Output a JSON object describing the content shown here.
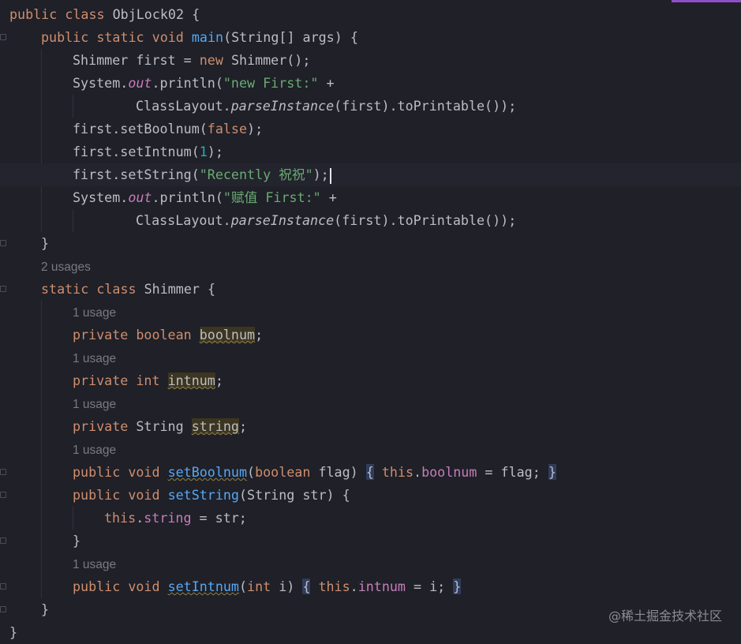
{
  "editor": {
    "lines": [
      {
        "id": "l1",
        "segments": [
          [
            "kw",
            "public class "
          ],
          [
            "plain",
            "ObjLock02 {"
          ]
        ]
      },
      {
        "id": "l2",
        "segments": [
          [
            "kw",
            "public static void "
          ],
          [
            "fn",
            "main"
          ],
          [
            "plain",
            "(String[] args) {"
          ]
        ]
      },
      {
        "id": "l3",
        "segments": [
          [
            "plain",
            "Shimmer first = "
          ],
          [
            "kw",
            "new "
          ],
          [
            "plain",
            "Shimmer();"
          ]
        ]
      },
      {
        "id": "l4",
        "segments": [
          [
            "plain",
            "System."
          ],
          [
            "out",
            "out"
          ],
          [
            "plain",
            ".println("
          ],
          [
            "str",
            "\"new First:\""
          ],
          [
            "plain",
            " +"
          ]
        ]
      },
      {
        "id": "l5",
        "segments": [
          [
            "plain",
            "ClassLayout."
          ],
          [
            "itl",
            "parseInstance"
          ],
          [
            "plain",
            "(first).toPrintable());"
          ]
        ]
      },
      {
        "id": "l6",
        "segments": [
          [
            "plain",
            "first.setBoolnum("
          ],
          [
            "kw",
            "false"
          ],
          [
            "plain",
            ");"
          ]
        ]
      },
      {
        "id": "l7",
        "segments": [
          [
            "plain",
            "first.setIntnum("
          ],
          [
            "num",
            "1"
          ],
          [
            "plain",
            ");"
          ]
        ]
      },
      {
        "id": "l8",
        "segments": [
          [
            "plain",
            "first.setString("
          ],
          [
            "str",
            "\"Recently 祝祝\""
          ],
          [
            "plain",
            ");"
          ]
        ]
      },
      {
        "id": "l9",
        "segments": [
          [
            "plain",
            "System."
          ],
          [
            "out",
            "out"
          ],
          [
            "plain",
            ".println("
          ],
          [
            "str",
            "\"赋值 First:\""
          ],
          [
            "plain",
            " +"
          ]
        ]
      },
      {
        "id": "l10",
        "segments": [
          [
            "plain",
            "ClassLayout."
          ],
          [
            "itl",
            "parseInstance"
          ],
          [
            "plain",
            "(first).toPrintable());"
          ]
        ]
      },
      {
        "id": "l11",
        "segments": [
          [
            "plain",
            "}"
          ]
        ]
      },
      {
        "id": "l12",
        "segments": [
          [
            "kw",
            "static class "
          ],
          [
            "plain",
            "Shimmer {"
          ]
        ]
      },
      {
        "id": "l13",
        "segments": [
          [
            "kw",
            "private boolean "
          ],
          [
            "unused",
            "boolnum"
          ],
          [
            "plain",
            ";"
          ]
        ]
      },
      {
        "id": "l14",
        "segments": [
          [
            "kw",
            "private int "
          ],
          [
            "unused",
            "intnum"
          ],
          [
            "plain",
            ";"
          ]
        ]
      },
      {
        "id": "l15",
        "segments": [
          [
            "kw",
            "private "
          ],
          [
            "plain",
            "String "
          ],
          [
            "unused",
            "string"
          ],
          [
            "plain",
            ";"
          ]
        ]
      },
      {
        "id": "l16",
        "segments": [
          [
            "kw",
            "public void "
          ],
          [
            "fnw",
            "setBoolnum"
          ],
          [
            "plain",
            "("
          ],
          [
            "kw",
            "boolean "
          ],
          [
            "plain",
            "flag) "
          ],
          [
            "hl",
            "{"
          ],
          [
            "plain",
            " "
          ],
          [
            "kw",
            "this"
          ],
          [
            "plain",
            "."
          ],
          [
            "fld",
            "boolnum"
          ],
          [
            "plain",
            " = flag; "
          ],
          [
            "hl",
            "}"
          ]
        ]
      },
      {
        "id": "l17",
        "segments": [
          [
            "kw",
            "public void "
          ],
          [
            "fn",
            "setString"
          ],
          [
            "plain",
            "(String str) {"
          ]
        ]
      },
      {
        "id": "l18",
        "segments": [
          [
            "kw",
            "this"
          ],
          [
            "plain",
            "."
          ],
          [
            "fld",
            "string"
          ],
          [
            "plain",
            " = str;"
          ]
        ]
      },
      {
        "id": "l19",
        "segments": [
          [
            "plain",
            "}"
          ]
        ]
      },
      {
        "id": "l20",
        "segments": [
          [
            "kw",
            "public void "
          ],
          [
            "fnw",
            "setIntnum"
          ],
          [
            "plain",
            "("
          ],
          [
            "kw",
            "int "
          ],
          [
            "plain",
            "i) "
          ],
          [
            "hl",
            "{"
          ],
          [
            "plain",
            " "
          ],
          [
            "kw",
            "this"
          ],
          [
            "plain",
            "."
          ],
          [
            "fld",
            "intnum"
          ],
          [
            "plain",
            " = i; "
          ],
          [
            "hl",
            "}"
          ]
        ]
      },
      {
        "id": "l21",
        "segments": [
          [
            "plain",
            "}"
          ]
        ]
      },
      {
        "id": "l22",
        "segments": [
          [
            "plain",
            "}"
          ]
        ]
      }
    ],
    "hints": {
      "h1": "2 usages",
      "h2": "1 usage",
      "h3": "1 usage",
      "h4": "1 usage",
      "h5": "1 usage",
      "h6": "1 usage"
    }
  },
  "watermark": "@稀土掘金技术社区",
  "colors": {
    "background": "#1f2028",
    "keyword": "#cf8e6d",
    "method": "#56a8f5",
    "string": "#6aab73",
    "number": "#2aacb8",
    "field": "#c77dbb",
    "text": "#bcbec4",
    "accent": "#8c4fc9"
  }
}
